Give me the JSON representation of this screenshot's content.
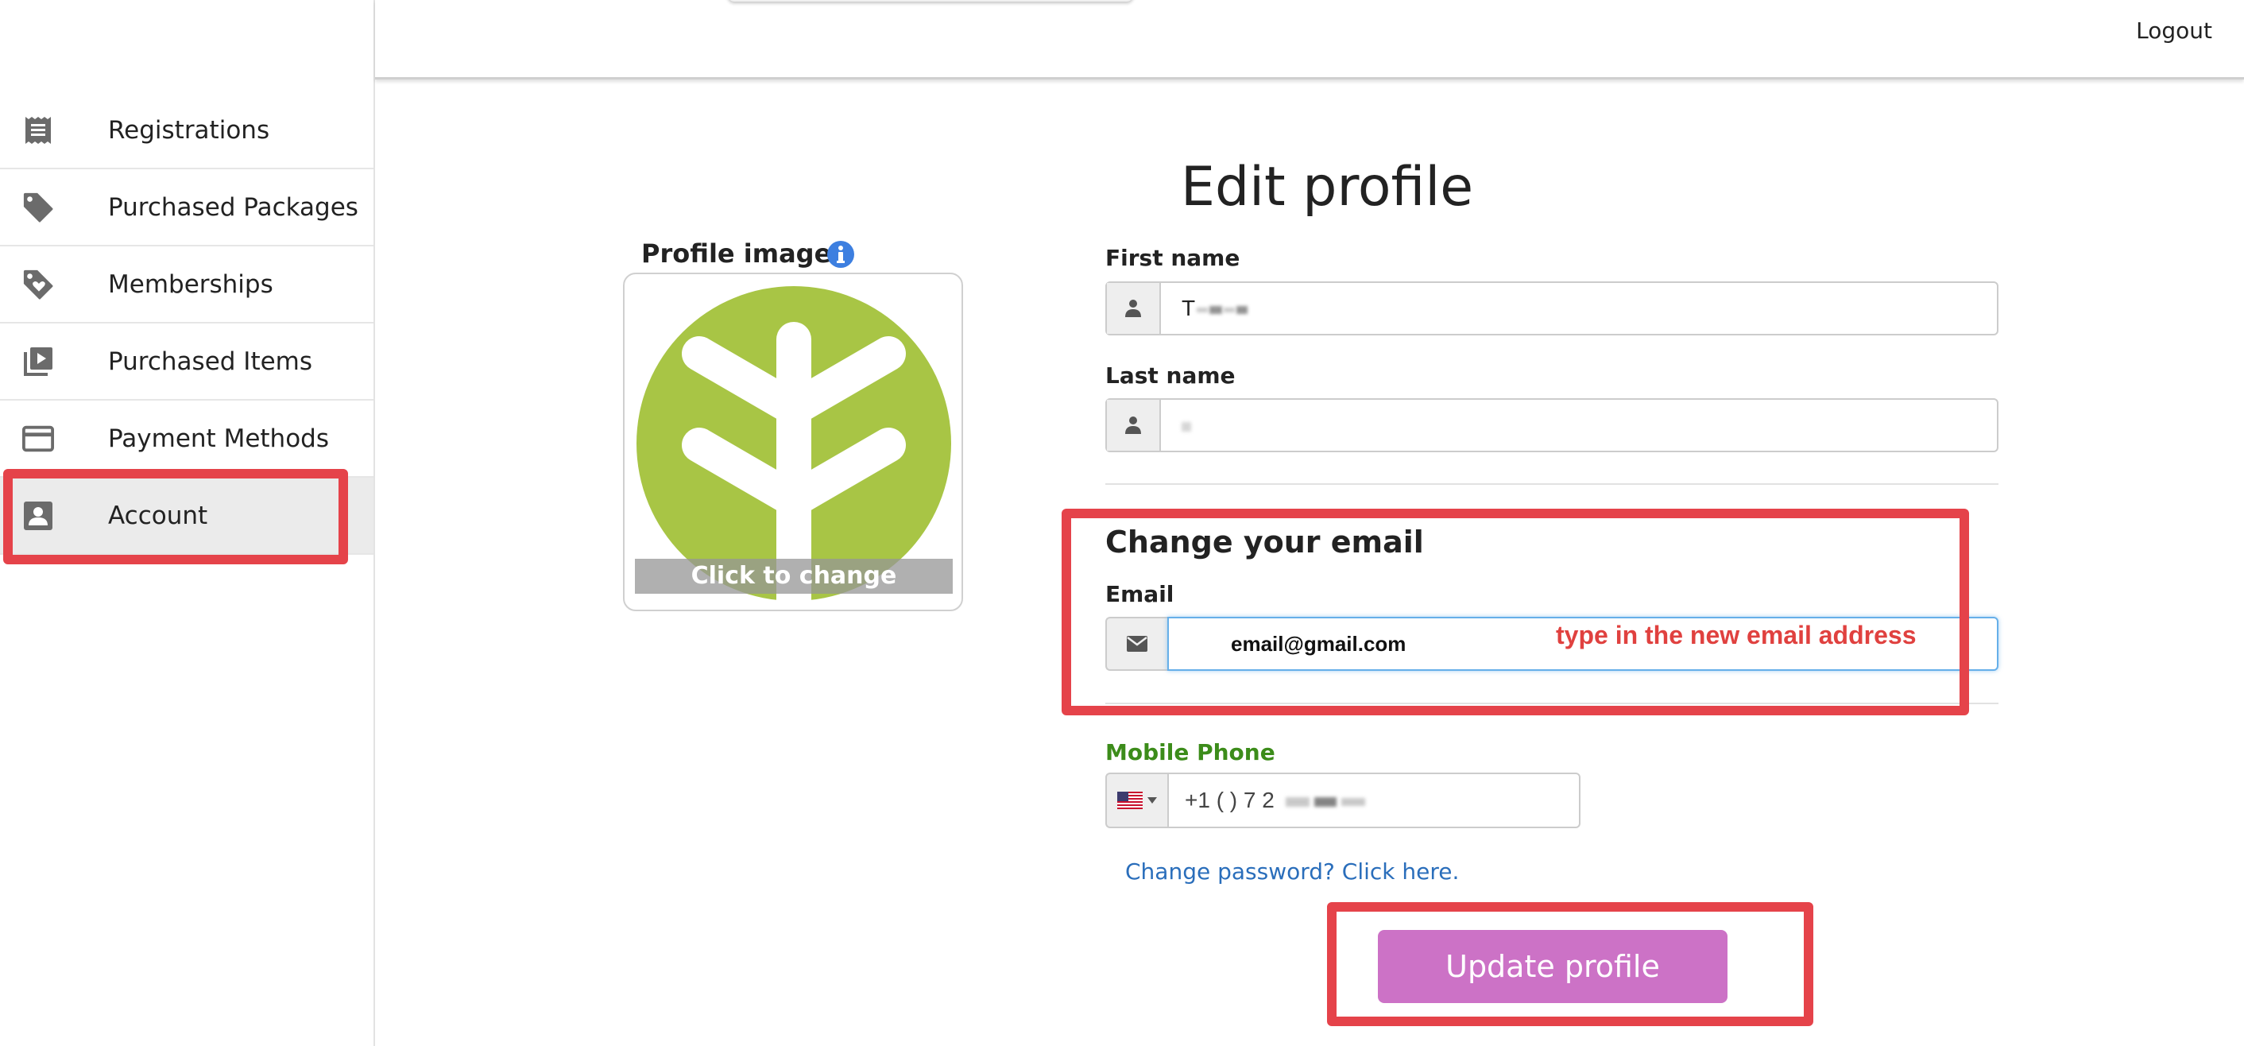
{
  "colors": {
    "annotation_red": "#e5434a",
    "update_button": "#cc72c6",
    "avatar_green": "#a8c545",
    "link_blue": "#2a6ebb",
    "phone_label_green": "#3c8c1a",
    "focus_blue": "#66afe9"
  },
  "sidebar": {
    "items": [
      {
        "label": "Registrations",
        "icon": "receipt-icon"
      },
      {
        "label": "Purchased Packages",
        "icon": "tag-icon"
      },
      {
        "label": "Memberships",
        "icon": "tag-heart-icon"
      },
      {
        "label": "Purchased Items",
        "icon": "video-library-icon"
      },
      {
        "label": "Payment Methods",
        "icon": "credit-card-icon"
      },
      {
        "label": "Account",
        "icon": "account-box-icon",
        "active": true
      }
    ]
  },
  "header": {
    "logout_label": "Logout"
  },
  "main": {
    "title": "Edit profile",
    "profile_image": {
      "label": "Profile image",
      "overlay_text": "Click to change"
    },
    "first_name": {
      "label": "First name",
      "value": "T"
    },
    "last_name": {
      "label": "Last name",
      "value": ""
    },
    "email_section": {
      "title": "Change your email",
      "label": "Email",
      "value": "email@gmail.com"
    },
    "annotation": "type in the new email address",
    "mobile_phone": {
      "label": "Mobile Phone",
      "value": "+1 (   )   7   2"
    },
    "change_password_link": "Change password? Click here.",
    "update_button": "Update profile"
  }
}
